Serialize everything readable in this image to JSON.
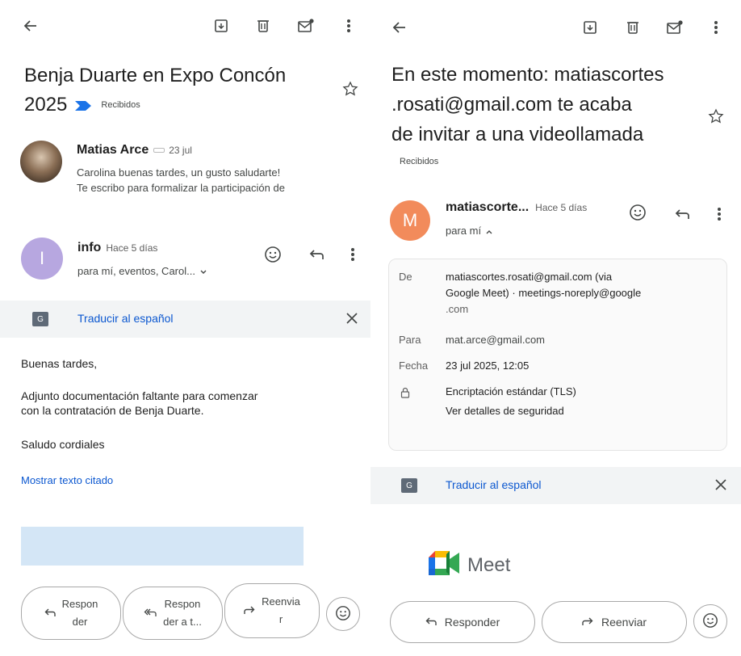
{
  "left": {
    "subject_line1": "Benja Duarte en Expo Concón",
    "subject_line2": "2025",
    "label": "Recibidos",
    "message1": {
      "sender": "Matias Arce",
      "date": "23 jul",
      "snippet_line1": "Carolina buenas tardes, un gusto saludarte!",
      "snippet_line2": "Te escribo para formalizar la participación de"
    },
    "message2": {
      "avatar_letter": "I",
      "sender": "info",
      "time": "Hace 5 días",
      "recipients": "para mí, eventos, Carol..."
    },
    "translate": "Traducir al español",
    "body": {
      "greeting": "Buenas tardes,",
      "line1": "Adjunto documentación faltante para comenzar",
      "line2": "con la contratación de Benja Duarte.",
      "closing": "Saludo cordiales"
    },
    "quoted_link": "Mostrar texto citado",
    "actions": {
      "reply_l1": "Respon",
      "reply_l2": "der",
      "reply_all_l1": "Respon",
      "reply_all_l2": "der a t...",
      "forward_l1": "Reenvia",
      "forward_l2": "r"
    }
  },
  "right": {
    "subject_line1": "En este momento: matiascortes",
    "subject_line2": ".rosati@gmail.com te acaba",
    "subject_line3": "de invitar a una videollamada",
    "label": "Recibidos",
    "message": {
      "avatar_letter": "M",
      "sender": "matiascorte...",
      "time": "Hace 5 días",
      "recipients": "para mí"
    },
    "details": {
      "from_label": "De",
      "from_line1": "matiascortes.rosati@gmail.com (via",
      "from_line2": "Google Meet) · meetings-noreply@google",
      "from_line3": ".com",
      "to_label": "Para",
      "to_value": "mat.arce@gmail.com",
      "date_label": "Fecha",
      "date_value": "23 jul 2025, 12:05",
      "enc_value": "Encriptación estándar (TLS)",
      "security_link": "Ver detalles de seguridad"
    },
    "translate": "Traducir al español",
    "meet_logo_text": "Meet",
    "actions": {
      "reply": "Responder",
      "forward": "Reenviar"
    }
  },
  "colors": {
    "link_blue": "#0b57d0",
    "avatar_info": "#b7a7e0",
    "avatar_m": "#f28b5b",
    "translate_bg": "#f2f4f5",
    "blurred_attachment": "#d4e6f6"
  }
}
